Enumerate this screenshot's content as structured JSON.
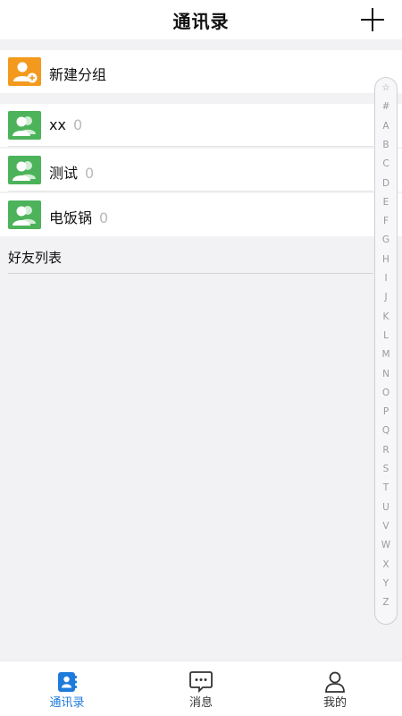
{
  "header": {
    "title": "通讯录",
    "add_icon": "plus-icon"
  },
  "new_group": {
    "label": "新建分组",
    "icon": "add-group-icon",
    "color": "#f39a1e"
  },
  "groups": [
    {
      "name": "xx",
      "count": "0",
      "icon": "group-icon",
      "color": "#4cb35a"
    },
    {
      "name": "测试",
      "count": "0",
      "icon": "group-icon",
      "color": "#4cb35a"
    },
    {
      "name": "电饭锅",
      "count": "0",
      "icon": "group-icon",
      "color": "#4cb35a"
    }
  ],
  "friends_section": {
    "title": "好友列表"
  },
  "alphabet_index": [
    "☆",
    "#",
    "A",
    "B",
    "C",
    "D",
    "E",
    "F",
    "G",
    "H",
    "I",
    "J",
    "K",
    "L",
    "M",
    "N",
    "O",
    "P",
    "Q",
    "R",
    "S",
    "T",
    "U",
    "V",
    "W",
    "X",
    "Y",
    "Z"
  ],
  "tabs": [
    {
      "label": "通讯录",
      "icon": "contacts-icon",
      "active": true
    },
    {
      "label": "消息",
      "icon": "message-icon",
      "active": false
    },
    {
      "label": "我的",
      "icon": "profile-icon",
      "active": false
    }
  ],
  "colors": {
    "accent": "#1e7bdc",
    "orange": "#f39a1e",
    "green": "#4cb35a"
  }
}
